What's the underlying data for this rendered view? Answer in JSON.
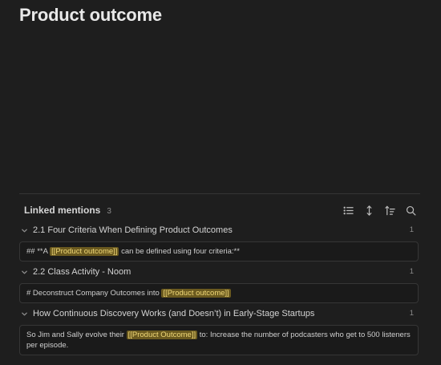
{
  "page": {
    "title": "Product outcome"
  },
  "mentions": {
    "title": "Linked mentions",
    "count": "3",
    "toolbar": [
      {
        "name": "list-icon"
      },
      {
        "name": "expand-collapse-icon"
      },
      {
        "name": "sort-icon"
      },
      {
        "name": "search-icon"
      }
    ],
    "groups": [
      {
        "title": "2.1 Four Criteria When Defining Product Outcomes",
        "count": "1",
        "snippet_before": "## **A ",
        "snippet_mark": "[[Product outcome]]",
        "snippet_after": " can be defined using four criteria:**"
      },
      {
        "title": "2.2 Class Activity - Noom",
        "count": "1",
        "snippet_before": "# Deconstruct Company Outcomes into ",
        "snippet_mark": "[[Product outcome]]",
        "snippet_after": ""
      },
      {
        "title": "How Continuous Discovery Works (and Doesn’t) in Early-Stage Startups",
        "count": "1",
        "snippet_before": "So Jim and Sally evolve their ",
        "snippet_mark": "[[Product Outcome]]",
        "snippet_after": " to: Increase the number of podcasters who get to 500 listeners per episode."
      }
    ]
  },
  "colors": {
    "background": "#1e1e1e",
    "highlight_bg": "#6b5a1f",
    "highlight_text": "#f0d878",
    "border": "#363636"
  }
}
